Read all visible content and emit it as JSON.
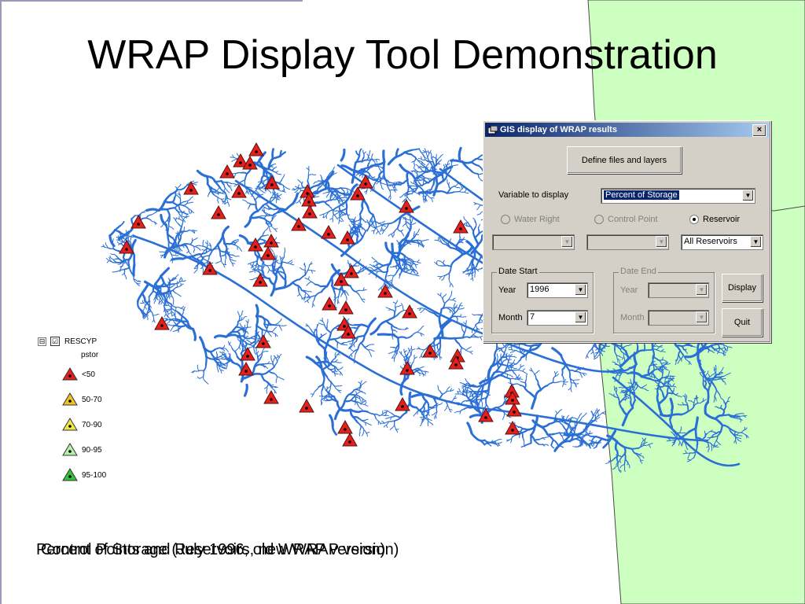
{
  "slide": {
    "title": "WRAP Display Tool Demonstration",
    "caption_a": "Percent of Storage (July 1996, old WRAP version)",
    "caption_b": "Control Points and Reservoirs, new WRAP version)"
  },
  "colors": {
    "river": "#2a6fd6",
    "green_area": "#ccffc0",
    "marker_low": "#e3201b",
    "marker_mid": "#f0e04a",
    "marker_high": "#34c23b"
  },
  "legend": {
    "expander": "⊟",
    "checkbox": "☑",
    "layer_name": "RESCYP",
    "field_name": "pstor",
    "classes": [
      "<50",
      "50-70",
      "70-90",
      "90-95",
      "95-100"
    ]
  },
  "dialog": {
    "title": "GIS display of WRAP results",
    "close_glyph": "×",
    "define_button": "Define files and layers",
    "variable_label": "Variable to display",
    "variable_value": "Percent of Storage",
    "radio_water_right": "Water Right",
    "radio_control_point": "Control Point",
    "radio_reservoir": "Reservoir",
    "combo_reservoir_value": "All Reservoirs",
    "date_start": {
      "caption": "Date Start",
      "year_label": "Year",
      "year_value": "1996",
      "month_label": "Month",
      "month_value": "7"
    },
    "date_end": {
      "caption": "Date End",
      "year_label": "Year",
      "month_label": "Month"
    },
    "display_button": "Display",
    "quit_button": "Quit"
  }
}
